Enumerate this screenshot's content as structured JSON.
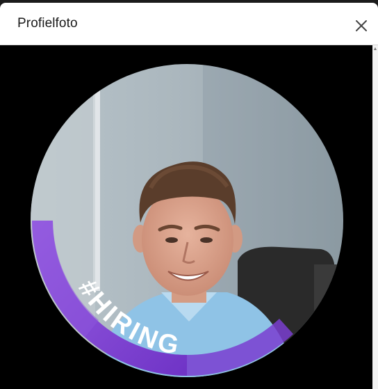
{
  "dialog": {
    "title": "Profielfoto",
    "close_icon": "close-icon"
  },
  "photo": {
    "frame_text": "#HIRING",
    "frame_color": "#7b3fcf",
    "frame_color_light": "#a77be8"
  },
  "scrollbar": {
    "arrow_icon": "chevron-up-icon"
  }
}
